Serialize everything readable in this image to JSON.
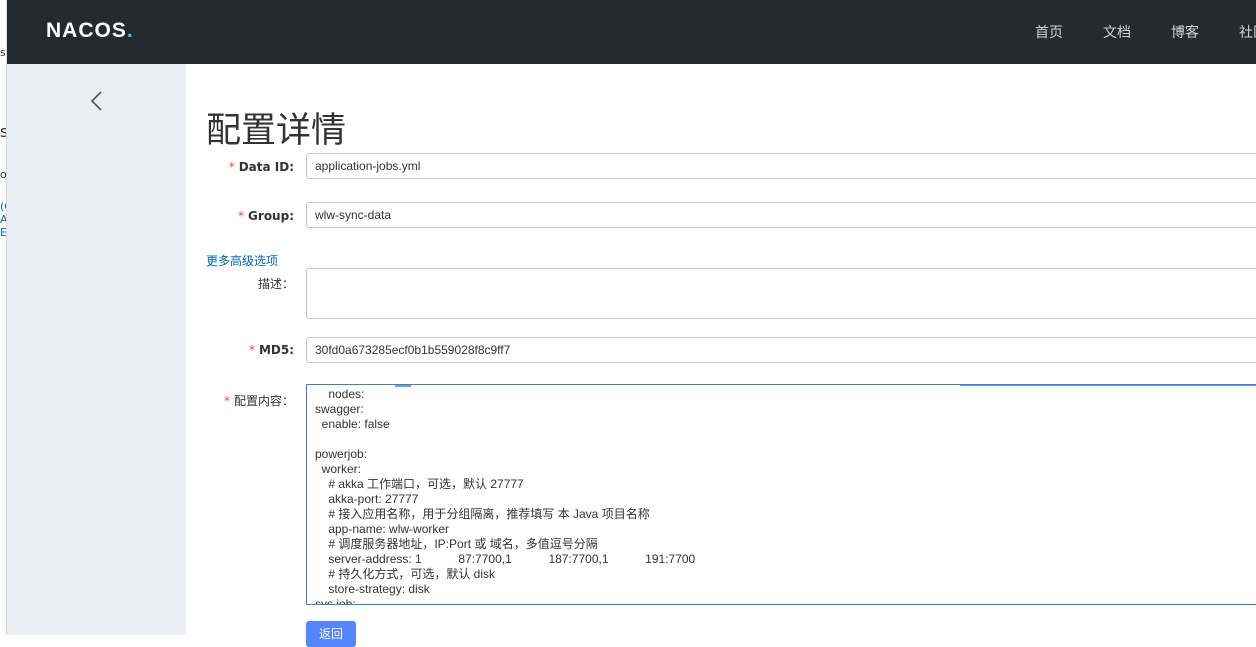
{
  "topbar": {
    "logo_main": "NACOS",
    "logo_dot": ".",
    "nav": [
      "首页",
      "文档",
      "博客",
      "社区"
    ]
  },
  "left_fragments": [
    "s",
    "s:",
    "or",
    "(C",
    "A",
    "E"
  ],
  "page": {
    "title": "配置详情"
  },
  "form": {
    "required_mark": "*",
    "data_id": {
      "label": "Data ID:",
      "value": "application-jobs.yml"
    },
    "group": {
      "label": "Group:",
      "value": "wlw-sync-data"
    },
    "more_options": "更多高级选项",
    "description": {
      "label": "描述：",
      "value": ""
    },
    "md5": {
      "label": "MD5:",
      "value": "30fd0a673285ecf0b1b559028f8c9ff7"
    },
    "content": {
      "label": "配置内容：",
      "lines": [
        "    nodes:",
        "swagger:",
        "  enable: false",
        "",
        "powerjob:",
        "  worker:",
        "    # akka 工作端口，可选，默认 27777",
        "    akka-port: 27777",
        "    # 接入应用名称，用于分组隔离，推荐填写 本 Java 项目名称",
        "    app-name: wlw-worker",
        "    # 调度服务器地址，IP:Port 或 域名，多值逗号分隔",
        "    server-address: 1           87:7700,1           187:7700,1           191:7700",
        "    # 持久化方式，可选，默认 disk",
        "    store-strategy: disk",
        "sys.job:"
      ]
    }
  },
  "buttons": {
    "back": "返回"
  },
  "colors": {
    "topbar": "#252a2f",
    "sidebar": "#ebeef2",
    "required": "#f44336",
    "link": "#0068b8",
    "primary": "#5584ff"
  }
}
